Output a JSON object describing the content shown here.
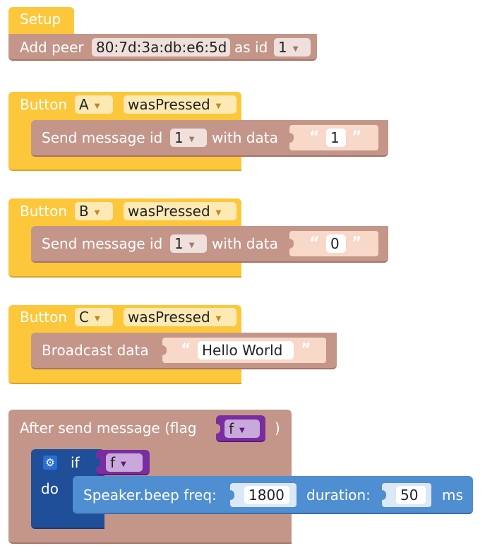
{
  "setup": {
    "hat_label": "Setup",
    "add_peer_label": "Add peer",
    "mac_address": "80:7d:3a:db:e6:5d",
    "as_id_label": "as id",
    "id_value": "1"
  },
  "button_a": {
    "button_label": "Button",
    "button_option": "A",
    "event_option": "wasPressed",
    "send_label": "Send message id",
    "id_value": "1",
    "with_data_label": "with data",
    "data_value": "1"
  },
  "button_b": {
    "button_label": "Button",
    "button_option": "B",
    "event_option": "wasPressed",
    "send_label": "Send message id",
    "id_value": "1",
    "with_data_label": "with data",
    "data_value": "0"
  },
  "button_c": {
    "button_label": "Button",
    "button_option": "C",
    "event_option": "wasPressed",
    "broadcast_label": "Broadcast data",
    "data_value": "Hello World"
  },
  "after_send": {
    "label_prefix": "After send message (flag",
    "flag_var": "f",
    "label_suffix": ")",
    "if_label": "if",
    "if_var": "f",
    "do_label": "do",
    "beep_label": "Speaker.beep freq:",
    "freq_value": "1800",
    "duration_label": "duration:",
    "duration_value": "50",
    "ms_label": "ms"
  },
  "colors": {
    "event_yellow": "#fcc73b",
    "comm_brown": "#c4968a",
    "variable_purple": "#7a2da0",
    "speaker_blue": "#4f8ed0",
    "logic_dark_blue": "#1f4f99"
  }
}
